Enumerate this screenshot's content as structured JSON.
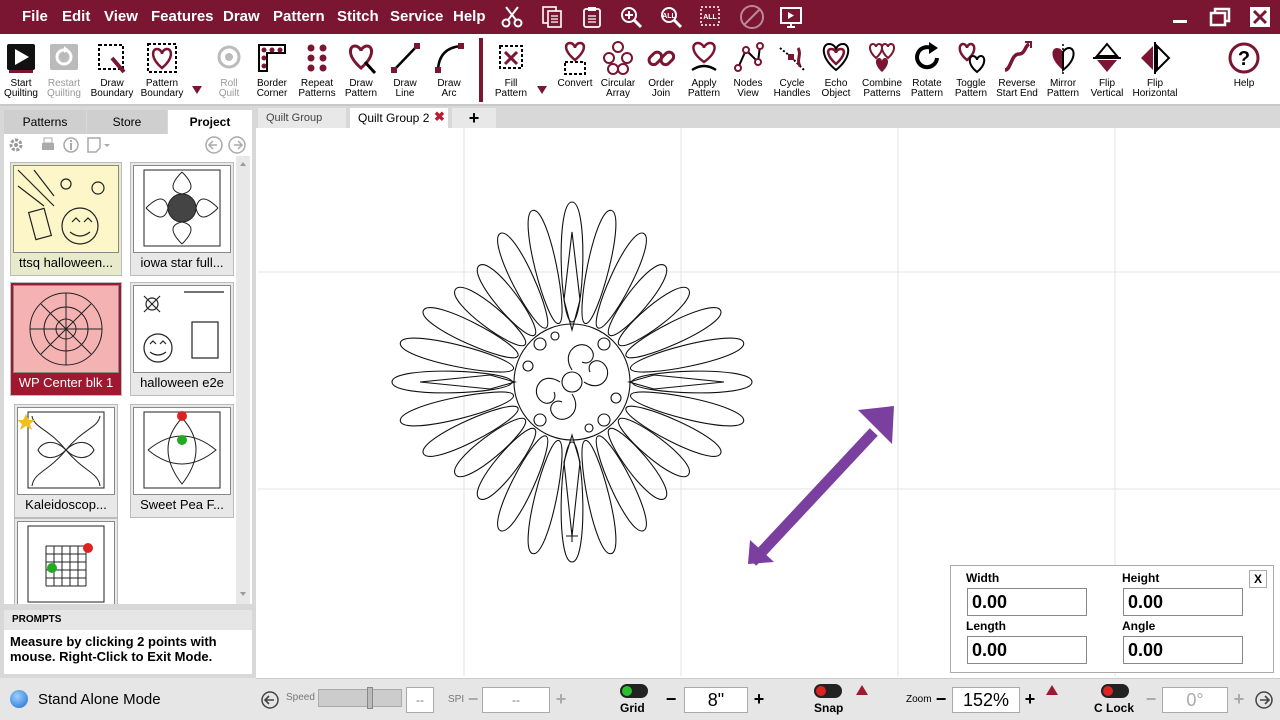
{
  "menu": [
    "File",
    "Edit",
    "View",
    "Features",
    "Draw",
    "Pattern",
    "Stitch",
    "Service",
    "Help"
  ],
  "quick_icons": [
    "scissors-icon",
    "copy-icon",
    "paste-icon",
    "zoom-in-icon",
    "zoom-all-icon",
    "zoom-selection-icon",
    "no-stitch-icon",
    "screen-icon"
  ],
  "toolbar": {
    "start_quilting": [
      "Start",
      "Quilting"
    ],
    "restart_quilting": [
      "Restart",
      "Quilting"
    ],
    "draw_boundary": [
      "Draw",
      "Boundary"
    ],
    "pattern_boundary": [
      "Pattern",
      "Boundary"
    ],
    "roll_quilt": [
      "Roll",
      "Quilt"
    ],
    "border_corner": [
      "Border",
      "Corner"
    ],
    "repeat_patterns": [
      "Repeat",
      "Patterns"
    ],
    "draw_pattern": [
      "Draw",
      "Pattern"
    ],
    "draw_line": [
      "Draw",
      "Line"
    ],
    "draw_arc": [
      "Draw",
      "Arc"
    ],
    "fill_pattern": [
      "Fill",
      "Pattern"
    ],
    "convert": [
      "Convert",
      ""
    ],
    "circular_array": [
      "Circular",
      "Array"
    ],
    "order_join": [
      "Order",
      "Join"
    ],
    "apply_pattern": [
      "Apply",
      "Pattern"
    ],
    "nodes_view": [
      "Nodes",
      "View"
    ],
    "cycle_handles": [
      "Cycle",
      "Handles"
    ],
    "echo_object": [
      "Echo",
      "Object"
    ],
    "combine_patterns": [
      "Combine",
      "Patterns"
    ],
    "rotate_pattern": [
      "Rotate",
      "Pattern"
    ],
    "toggle_pattern": [
      "Toggle",
      "Pattern"
    ],
    "reverse_start_end": [
      "Reverse",
      "Start End"
    ],
    "mirror_pattern": [
      "Mirror",
      "Pattern"
    ],
    "flip_vertical": [
      "Flip",
      "Vertical"
    ],
    "flip_horizontal": [
      "Flip",
      "Horizontal"
    ],
    "help": [
      "Help",
      ""
    ]
  },
  "panel": {
    "tabs": [
      "Patterns",
      "Store",
      "Project"
    ],
    "active_tab": "Project",
    "thumbnails": [
      "ttsq halloween...",
      "iowa star full...",
      "WP Center blk 1",
      "halloween e2e",
      "Kaleidoscop...",
      "Sweet Pea F...",
      ""
    ],
    "prompts_title": "PROMPTS",
    "prompts_text": "Measure by clicking 2 points with mouse. Right-Click to Exit Mode."
  },
  "canvas_tabs": [
    "Quilt Group",
    "Quilt Group 2"
  ],
  "dimensions": {
    "width_label": "Width",
    "width_value": "0.00",
    "height_label": "Height",
    "height_value": "0.00",
    "length_label": "Length",
    "length_value": "0.00",
    "angle_label": "Angle",
    "angle_value": "0.00",
    "close_label": "X"
  },
  "status": {
    "mode": "Stand Alone Mode",
    "speed_label": "Speed",
    "speed_value": "--",
    "spi_label": "SPI",
    "spi_value": "--",
    "grid_label": "Grid",
    "grid_value": "8\"",
    "snap_label": "Snap",
    "zoom_label": "Zoom",
    "zoom_value": "152%",
    "clock_label": "C Lock",
    "angle_value": "0°"
  },
  "colors": {
    "brand": "#7a1631",
    "arrow": "#7b3fa0",
    "selected": "#a0182f"
  }
}
